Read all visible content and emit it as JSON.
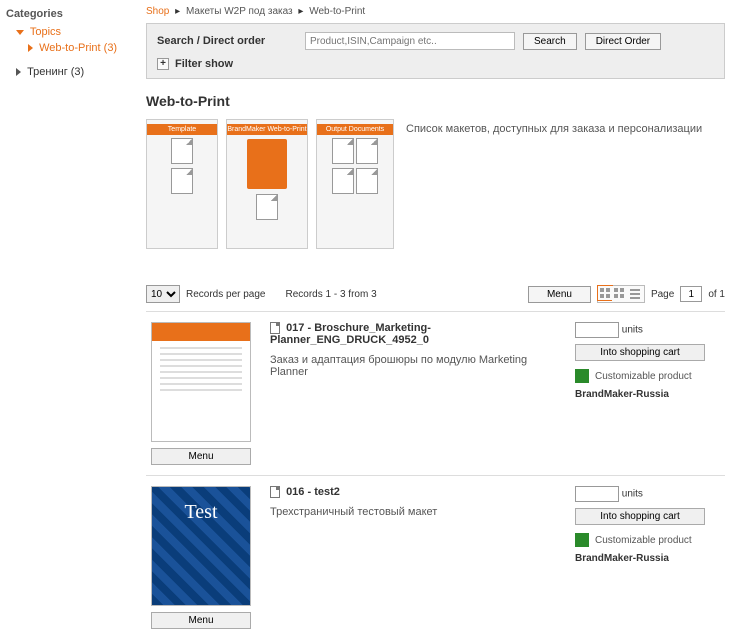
{
  "sidebar": {
    "title": "Categories",
    "items": [
      {
        "label": "Topics",
        "expanded": true,
        "orange": true,
        "children": [
          {
            "label": "Web-to-Print (3)",
            "orange": true
          }
        ]
      },
      {
        "label": "Тренинг (3)",
        "expanded": false
      }
    ]
  },
  "breadcrumb": {
    "items": [
      "Shop",
      "Макеты W2P под заказ",
      "Web-to-Print"
    ]
  },
  "search": {
    "label": "Search / Direct order",
    "placeholder": "Product,ISIN,Campaign etc..",
    "search_btn": "Search",
    "direct_btn": "Direct Order",
    "filter_label": "Filter show"
  },
  "page": {
    "title": "Web-to-Print",
    "description": "Список макетов, доступных для заказа и персонализации"
  },
  "diagram": {
    "col1": "Template",
    "col2": "BrandMaker Web-to-Print",
    "col3": "Output Documents"
  },
  "toolbar": {
    "per_page_value": "10",
    "per_page_label": "Records per page",
    "records_text": "Records 1 - 3 from 3",
    "menu_btn": "Menu",
    "page_label": "Page",
    "page_value": "1",
    "page_of": "of 1"
  },
  "products": [
    {
      "title": "017 - Broschure_Marketing-Planner_ENG_DRUCK_4952_0",
      "desc": "Заказ и адаптация брошюры по модулю Marketing Planner",
      "menu": "Menu",
      "units": "units",
      "cart": "Into shopping cart",
      "customizable": "Customizable product",
      "brand": "BrandMaker-Russia",
      "thumb_type": "orange"
    },
    {
      "title": "016 - test2",
      "desc": "Трехстраничный тестовый макет",
      "menu": "Menu",
      "units": "units",
      "cart": "Into shopping cart",
      "customizable": "Customizable product",
      "brand": "BrandMaker-Russia",
      "thumb_type": "blue",
      "thumb_text": "Test"
    }
  ]
}
